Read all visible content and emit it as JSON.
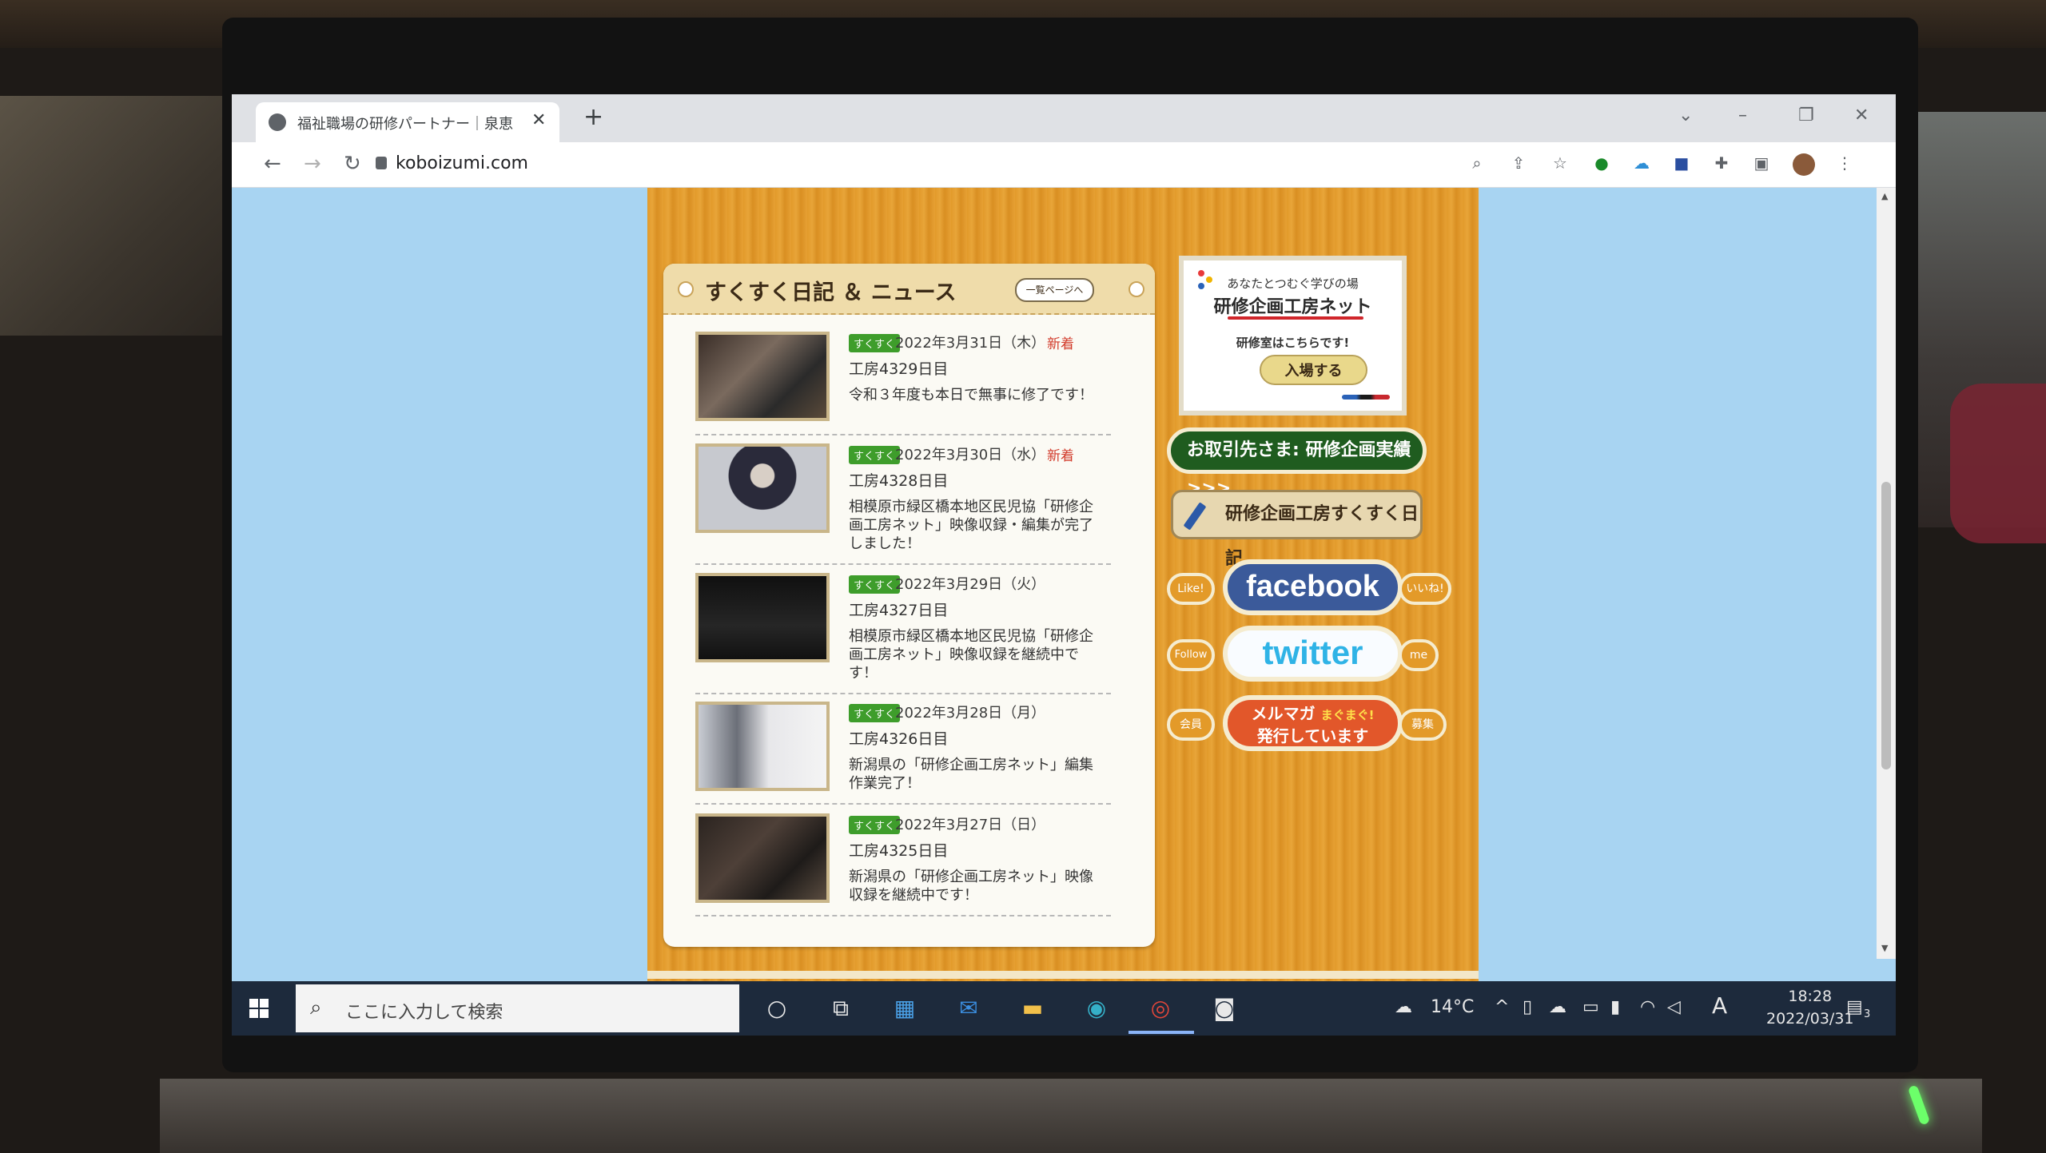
{
  "browser": {
    "tab_title": "福祉職場の研修パートナー｜泉恵造",
    "tab_close": "✕",
    "new_tab": "+",
    "url": "koboizumi.com"
  },
  "news": {
    "heading": "すくすく日記 ＆ ニュース",
    "more_label": "一覧ページへ",
    "items": [
      {
        "badge": "すくすく",
        "date": "2022年3月31日（木）",
        "new": "新着",
        "name": "工房4329日目",
        "desc": "令和３年度も本日で無事に修了です！"
      },
      {
        "badge": "すくすく",
        "date": "2022年3月30日（水）",
        "new": "新着",
        "name": "工房4328日目",
        "desc": "相模原市緑区橋本地区民児協「研修企画工房ネット」映像収録・編集が完了しました！"
      },
      {
        "badge": "すくすく",
        "date": "2022年3月29日（火）",
        "new": "",
        "name": "工房4327日目",
        "desc": "相模原市緑区橋本地区民児協「研修企画工房ネット」映像収録を継続中です！"
      },
      {
        "badge": "すくすく",
        "date": "2022年3月28日（月）",
        "new": "",
        "name": "工房4326日目",
        "desc": "新潟県の「研修企画工房ネット」編集作業完了！"
      },
      {
        "badge": "すくすく",
        "date": "2022年3月27日（日）",
        "new": "",
        "name": "工房4325日目",
        "desc": "新潟県の「研修企画工房ネット」映像収録を継続中です！"
      }
    ]
  },
  "sidebar": {
    "promo_sub": "あなたとつむぐ学びの場",
    "promo_title": "研修企画工房ネット",
    "promo_note": "研修室はこちらです!",
    "promo_enter": "入場する",
    "clients_btn": "お取引先さま: 研修企画実績 >>>",
    "diary_btn": "研修企画工房すくすく日記",
    "fb_left": "Like!",
    "fb_main": "facebook",
    "fb_right": "いいね!",
    "tw_left": "Follow",
    "tw_main": "twitter",
    "tw_right": "me",
    "mm_left": "会員",
    "mm_main": "メルマガ",
    "mm_main2": "発行しています",
    "mm_accent": "まぐまぐ!",
    "mm_right": "募集"
  },
  "taskbar": {
    "search_placeholder": "ここに入力して検索",
    "weather": "14°C",
    "ime": "A",
    "time": "18:28",
    "date": "2022/03/31",
    "notifications": "3"
  },
  "colors": {
    "page_bg": "#a8d4f2",
    "wood": "#e29a2a",
    "badge_green": "#3e9d2b",
    "new_red": "#d23b2b",
    "facebook_blue": "#3b5a9a",
    "twitter_blue": "#2fb3e6"
  }
}
